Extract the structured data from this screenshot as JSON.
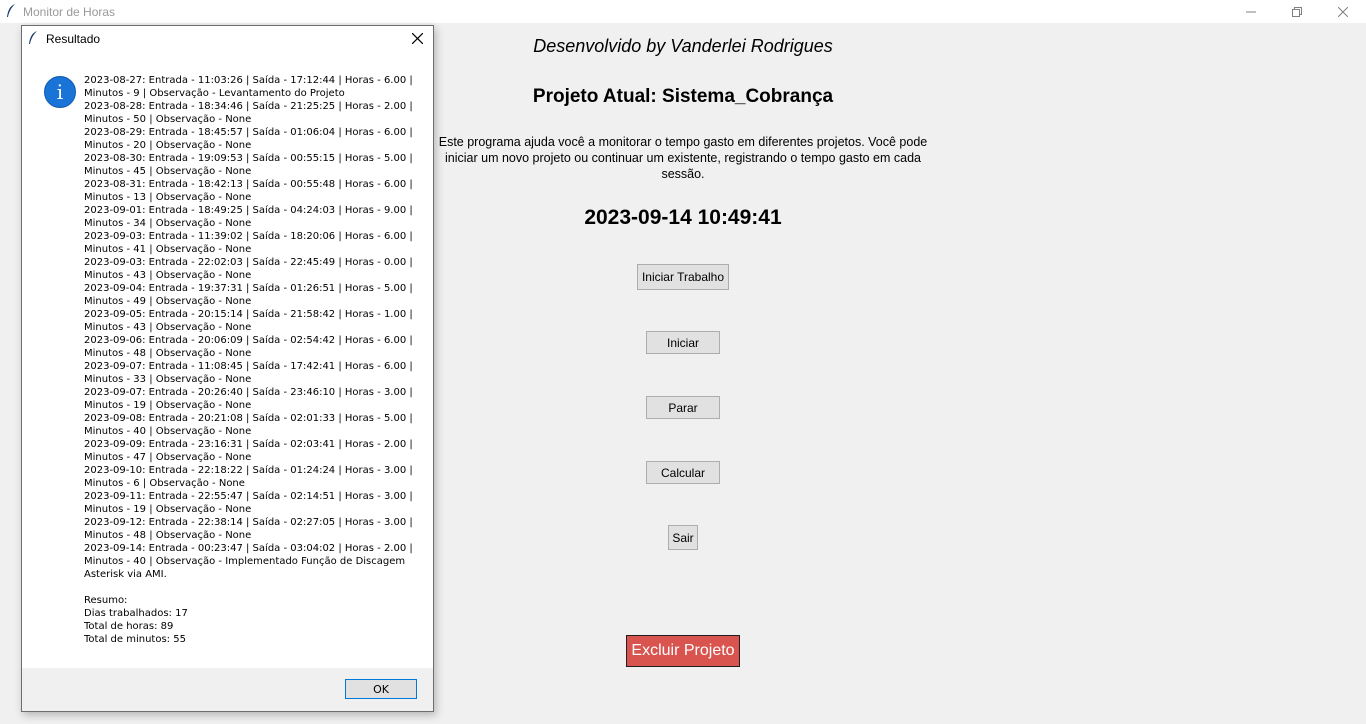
{
  "window": {
    "title": "Monitor de Horas",
    "icon": "feather-icon"
  },
  "main": {
    "developer": "Desenvolvido by Vanderlei Rodrigues",
    "project": "Projeto Atual: Sistema_Cobrança",
    "description": "Este programa ajuda você a monitorar o tempo gasto em diferentes projetos. Você pode iniciar um novo projeto ou continuar um existente, registrando o tempo gasto em cada sessão.",
    "clock": "2023-09-14 10:49:41",
    "buttons": {
      "iniciar_trabalho": "Iniciar Trabalho",
      "iniciar": "Iniciar",
      "parar": "Parar",
      "calcular": "Calcular",
      "sair": "Sair",
      "excluir": "Excluir Projeto"
    },
    "colors": {
      "excluir_bg": "#d9534f",
      "background": "#f0f0f0"
    }
  },
  "dialog": {
    "title": "Resultado",
    "icon": "info-icon",
    "message": "2023-08-27: Entrada - 11:03:26 | Saída - 17:12:44 | Horas - 6.00 | Minutos - 9 | Observação - Levantamento do Projeto\n2023-08-28: Entrada - 18:34:46 | Saída - 21:25:25 | Horas - 2.00 | Minutos - 50 | Observação - None\n2023-08-29: Entrada - 18:45:57 | Saída - 01:06:04 | Horas - 6.00 | Minutos - 20 | Observação - None\n2023-08-30: Entrada - 19:09:53 | Saída - 00:55:15 | Horas - 5.00 | Minutos - 45 | Observação - None\n2023-08-31: Entrada - 18:42:13 | Saída - 00:55:48 | Horas - 6.00 | Minutos - 13 | Observação - None\n2023-09-01: Entrada - 18:49:25 | Saída - 04:24:03 | Horas - 9.00 | Minutos - 34 | Observação - None\n2023-09-03: Entrada - 11:39:02 | Saída - 18:20:06 | Horas - 6.00 | Minutos - 41 | Observação - None\n2023-09-03: Entrada - 22:02:03 | Saída - 22:45:49 | Horas - 0.00 | Minutos - 43 | Observação - None\n2023-09-04: Entrada - 19:37:31 | Saída - 01:26:51 | Horas - 5.00 | Minutos - 49 | Observação - None\n2023-09-05: Entrada - 20:15:14 | Saída - 21:58:42 | Horas - 1.00 | Minutos - 43 | Observação - None\n2023-09-06: Entrada - 20:06:09 | Saída - 02:54:42 | Horas - 6.00 | Minutos - 48 | Observação - None\n2023-09-07: Entrada - 11:08:45 | Saída - 17:42:41 | Horas - 6.00 | Minutos - 33 | Observação - None\n2023-09-07: Entrada - 20:26:40 | Saída - 23:46:10 | Horas - 3.00 | Minutos - 19 | Observação - None\n2023-09-08: Entrada - 20:21:08 | Saída - 02:01:33 | Horas - 5.00 | Minutos - 40 | Observação - None\n2023-09-09: Entrada - 23:16:31 | Saída - 02:03:41 | Horas - 2.00 | Minutos - 47 | Observação - None\n2023-09-10: Entrada - 22:18:22 | Saída - 01:24:24 | Horas - 3.00 | Minutos - 6 | Observação - None\n2023-09-11: Entrada - 22:55:47 | Saída - 02:14:51 | Horas - 3.00 | Minutos - 19 | Observação - None\n2023-09-12: Entrada - 22:38:14 | Saída - 02:27:05 | Horas - 3.00 | Minutos - 48 | Observação - None\n2023-09-14: Entrada - 00:23:47 | Saída - 03:04:02 | Horas - 2.00 | Minutos - 40 | Observação - Implementado Função de Discagem Asterisk via AMI.\n\nResumo:\nDias trabalhados: 17\nTotal de horas: 89\nTotal de minutos: 55",
    "ok_label": "OK"
  }
}
